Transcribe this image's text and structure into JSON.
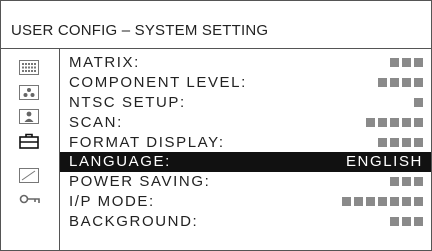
{
  "window": {
    "title": "USER CONFIG – SYSTEM SETTING"
  },
  "sidebar": {
    "icons": [
      {
        "name": "dot-grid-icon"
      },
      {
        "name": "color-dots-icon"
      },
      {
        "name": "person-icon"
      },
      {
        "name": "toolbox-icon",
        "active": true
      },
      {
        "name": "adjust-slope-icon"
      },
      {
        "name": "key-icon"
      }
    ]
  },
  "menu": {
    "items": [
      {
        "label": "MATRIX:",
        "value_blocks": 3
      },
      {
        "label": "COMPONENT LEVEL:",
        "value_blocks": 4
      },
      {
        "label": "NTSC SETUP:",
        "value_blocks": 1
      },
      {
        "label": "SCAN:",
        "value_blocks": 5
      },
      {
        "label": "FORMAT DISPLAY:",
        "value_blocks": 4
      },
      {
        "label": "LANGUAGE:",
        "value_text": "ENGLISH",
        "selected": true
      },
      {
        "label": "POWER SAVING:",
        "value_blocks": 3
      },
      {
        "label": "I/P MODE:",
        "value_blocks": 7
      },
      {
        "label": "BACKGROUND:",
        "value_blocks": 3
      }
    ]
  },
  "colors": {
    "selected_bg": "#111111",
    "masked_value": "#8a8a8a",
    "border": "#555555"
  }
}
